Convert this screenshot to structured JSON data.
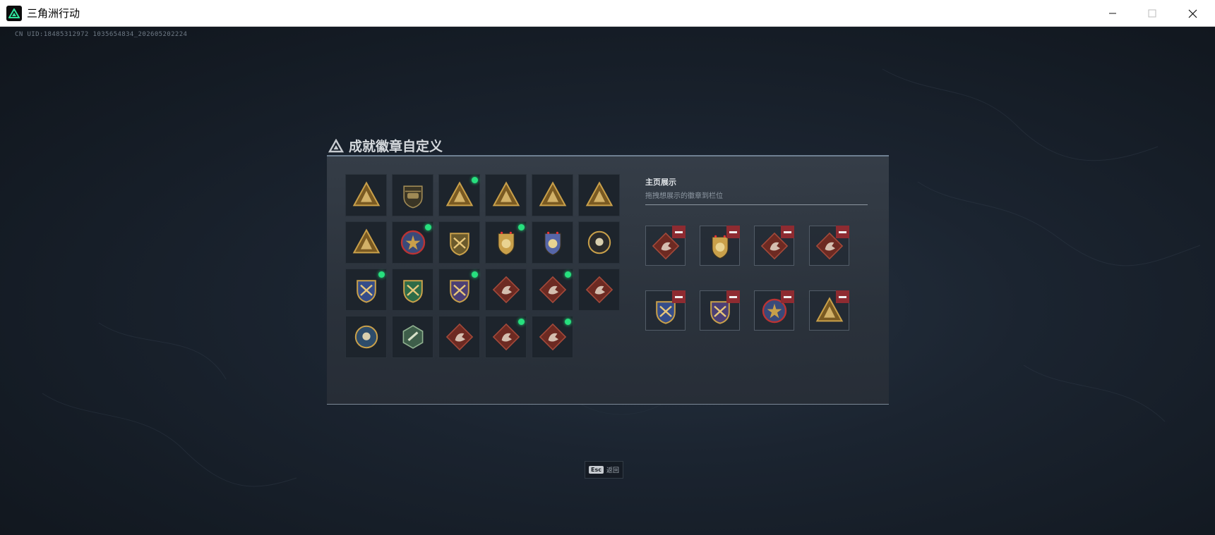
{
  "window": {
    "title": "三角洲行动",
    "controls": {
      "minimize": "minimize-icon",
      "maximize": "maximize-icon",
      "close": "close-icon"
    }
  },
  "uid_text": "CN UID:18485312972 1035654834_202605202224",
  "panel": {
    "title": "成就徽章自定义",
    "badges": [
      {
        "icon": "triangle-shield-badge-icon",
        "new": false
      },
      {
        "icon": "helicopter-badge-icon",
        "new": false
      },
      {
        "icon": "gold-triangle-badge-icon",
        "new": true
      },
      {
        "icon": "gold-triangle-vault-badge-icon",
        "new": false
      },
      {
        "icon": "gold-triangle-box-badge-icon",
        "new": false
      },
      {
        "icon": "gold-triangle-number-one-badge-icon",
        "new": false
      },
      {
        "icon": "mountain-triangle-badge-icon",
        "new": false
      },
      {
        "icon": "red-star-medal-badge-icon",
        "new": true
      },
      {
        "icon": "gold-wing-shield-badge-icon",
        "new": false
      },
      {
        "icon": "police-gold-badge-icon",
        "new": true
      },
      {
        "icon": "police-blue-badge-icon",
        "new": false
      },
      {
        "icon": "skull-crosshair-badge-icon",
        "new": false
      },
      {
        "icon": "crossed-rifles-blue-shield-badge-icon",
        "new": true
      },
      {
        "icon": "green-crosshair-shield-badge-icon",
        "new": false
      },
      {
        "icon": "crossed-rifles-purple-shield-badge-icon",
        "new": true
      },
      {
        "icon": "wolf-diamond-badge-icon",
        "new": false
      },
      {
        "icon": "wolf-diamond-badge-icon",
        "new": true
      },
      {
        "icon": "horse-diamond-badge-icon",
        "new": false
      },
      {
        "icon": "eagle-round-badge-icon",
        "new": false
      },
      {
        "icon": "green-hexagon-badge-icon",
        "new": false
      },
      {
        "icon": "dragon-diamond-badge-icon",
        "new": false
      },
      {
        "icon": "dragon-diamond-badge-icon",
        "new": true
      },
      {
        "icon": "runner-diamond-badge-icon",
        "new": true
      }
    ],
    "showcase": {
      "title": "主页展示",
      "subtitle": "拖拽想展示的徽章到栏位",
      "slots": [
        {
          "icon": "wolf-diamond-badge-icon"
        },
        {
          "icon": "police-gold-badge-icon"
        },
        {
          "icon": "dragon-diamond-badge-icon"
        },
        {
          "icon": "horse-diamond-badge-icon"
        },
        {
          "icon": "crossed-rifles-blue-shield-badge-icon"
        },
        {
          "icon": "crossed-rifles-purple-shield-badge-icon"
        },
        {
          "icon": "red-star-medal-badge-icon"
        },
        {
          "icon": "gold-triangle-badge-icon"
        }
      ]
    }
  },
  "esc_hint": {
    "key": "Esc",
    "label": "返回"
  },
  "colors": {
    "accent_green": "#27e07e",
    "remove_red": "#8e2b31",
    "gold": "#c9a04a",
    "bronze_red": "#7a3a2a"
  }
}
